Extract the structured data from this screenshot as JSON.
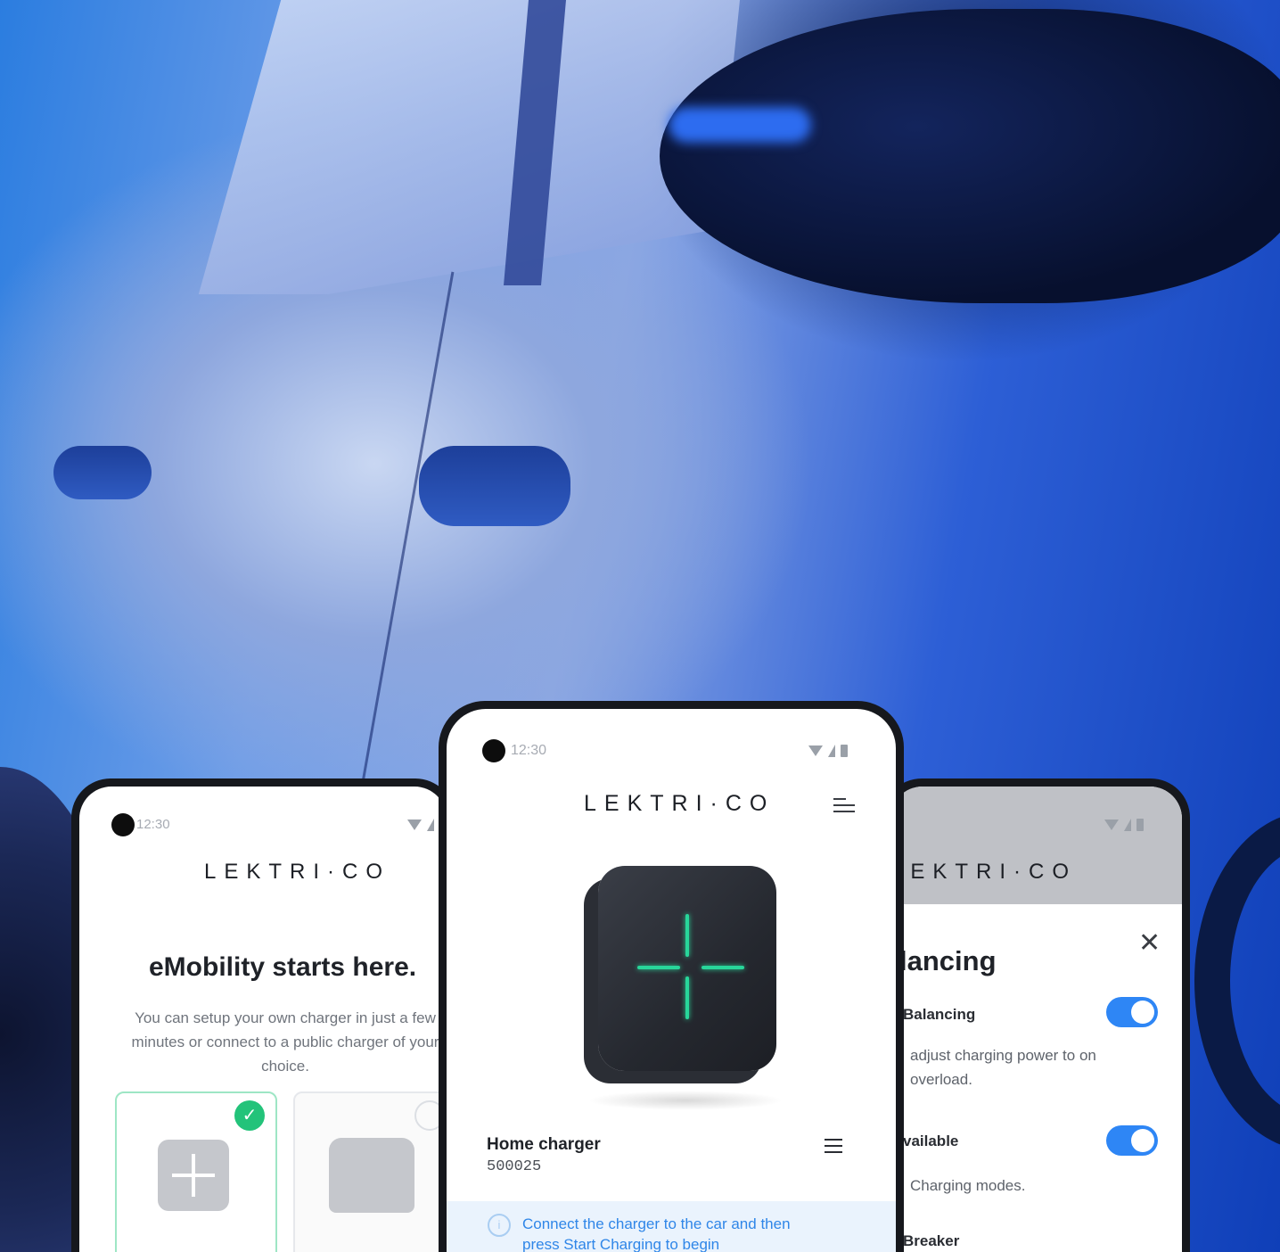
{
  "status": {
    "time": "12:30"
  },
  "brand": {
    "logo": "LEKTRI·CO"
  },
  "left_screen": {
    "title": "eMobility starts here.",
    "subtitle": "You can setup your own charger in just a few minutes or connect to a public charger of your choice.",
    "check_symbol": "✓",
    "cards": [
      {
        "icon": "plus-tile-icon",
        "selected": true
      },
      {
        "icon": "car-charging-icon",
        "selected": false
      }
    ]
  },
  "center_screen": {
    "charger_name": "Home charger",
    "charger_serial": "500025",
    "info_text": "Connect the charger to the car and then press Start Charging to begin"
  },
  "right_screen": {
    "title": "lancing",
    "close_symbol": "✕",
    "setting_1_label": "Balancing",
    "setting_1_text": "adjust charging power to on overload.",
    "setting_1_enabled": true,
    "setting_2_label": "vailable",
    "setting_2_text": "Charging modes.",
    "setting_2_enabled": true,
    "setting_3_label": "Breaker"
  },
  "colors": {
    "accent_blue": "#2e86f5",
    "success_green": "#23c37a",
    "glow_green": "#28d69a",
    "info_text_blue": "#2f86e8"
  }
}
